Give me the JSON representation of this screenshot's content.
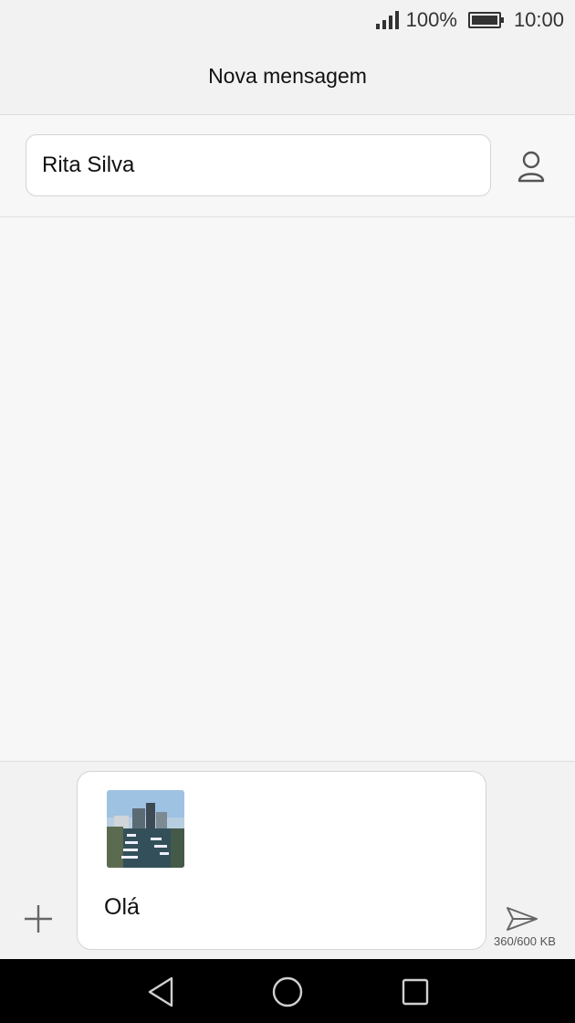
{
  "status_bar": {
    "battery_percent": "100%",
    "battery_level": 1.0,
    "time": "10:00",
    "icons": [
      "signal-icon",
      "battery-icon"
    ]
  },
  "header": {
    "title": "Nova mensagem"
  },
  "recipient": {
    "value": "Rita Silva",
    "contact_icon": "person-icon"
  },
  "composer": {
    "attachment_image": "harbor-photo",
    "text": "Olá",
    "size_label": "360/600 KB",
    "attach_icon": "plus-icon",
    "send_icon": "send-icon"
  },
  "nav": {
    "icons": [
      "back-triangle-icon",
      "home-circle-icon",
      "recents-square-icon"
    ]
  },
  "colors": {
    "bar_bg": "#f2f2f2",
    "page_bg": "#f7f7f7",
    "nav_bg": "#000000"
  }
}
